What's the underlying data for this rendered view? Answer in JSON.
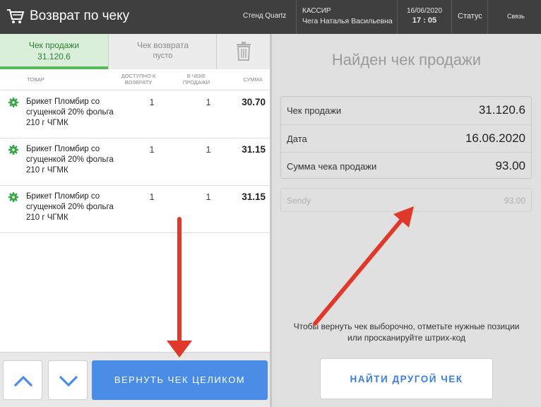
{
  "header": {
    "title": "Возврат по чеку",
    "stand": "Стенд Quartz",
    "cashier_label": "КАССИР",
    "cashier_name": "Чега Наталья Васильевна",
    "date": "16/06/2020",
    "time": "17 : 05",
    "status": "Статус",
    "link": "Связь"
  },
  "tabs": {
    "sale_label": "Чек продажи",
    "sale_number": "31.120.6",
    "return_label": "Чек возврата",
    "return_value": "пусто"
  },
  "table": {
    "headers": {
      "item": "ТОВАР",
      "available": "ДОСТУПНО К ВОЗВРАТУ",
      "in_check": "В ЧЕКЕ ПРОДАЖИ",
      "sum": "СУММА"
    },
    "rows": [
      {
        "name": "Брикет Пломбир со сгущенкой 20% фольга 210 г ЧГМК",
        "available": "1",
        "in_check": "1",
        "sum": "30.70"
      },
      {
        "name": "Брикет Пломбир со сгущенкой 20% фольга 210 г ЧГМК",
        "available": "1",
        "in_check": "1",
        "sum": "31.15"
      },
      {
        "name": "Брикет Пломбир со сгущенкой 20% фольга 210 г ЧГМК",
        "available": "1",
        "in_check": "1",
        "sum": "31.15"
      }
    ]
  },
  "footer": {
    "return_all_label": "ВЕРНУТЬ ЧЕК ЦЕЛИКОМ"
  },
  "right_panel": {
    "heading": "Найден чек продажи",
    "info": [
      {
        "label": "Чек продажи",
        "value": "31.120.6"
      },
      {
        "label": "Дата",
        "value": "16.06.2020"
      },
      {
        "label": "Сумма чека продажи",
        "value": "93.00"
      }
    ],
    "payment": {
      "label": "Sendy",
      "value": "93.00"
    },
    "hint": "Чтобы вернуть чек выборочно, отметьте нужные позиции или просканируйте штрих-код",
    "find_label": "НАЙТИ ДРУГОЙ ЧЕК"
  },
  "colors": {
    "accent_green": "#5cb85c",
    "button_blue": "#4a8de6",
    "arrow_red": "#e0392b",
    "header_bg": "#3f3f3f"
  },
  "icons": [
    "cart-icon",
    "trash-icon",
    "gear-icon",
    "chevron-up-icon",
    "chevron-down-icon"
  ]
}
